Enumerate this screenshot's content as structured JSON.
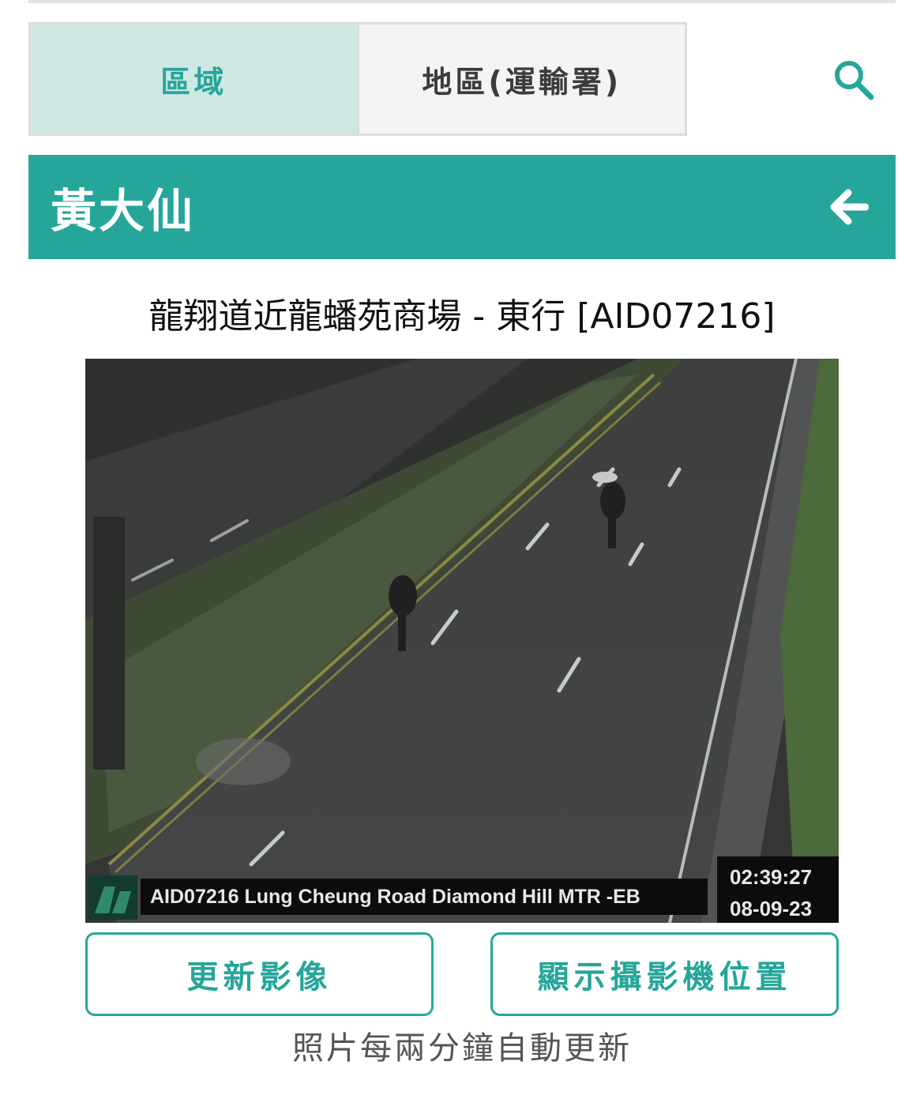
{
  "tabs": {
    "region_label": "區域",
    "district_label": "地區(運輸署)"
  },
  "icons": {
    "search": "search-icon",
    "back": "arrow-left-icon"
  },
  "banner": {
    "title": "黃大仙"
  },
  "camera": {
    "title": "龍翔道近龍蟠苑商場 - 東行 [AID07216]",
    "overlay_caption": "AID07216 Lung Cheung Road Diamond Hill MTR -EB",
    "overlay_time": "02:39:27",
    "overlay_date": "08-09-23"
  },
  "actions": {
    "refresh_label": "更新影像",
    "location_label": "顯示攝影機位置"
  },
  "footnote": "照片每兩分鐘自動更新",
  "colors": {
    "accent": "#26a69a",
    "active_tab_bg": "#cfe7e3"
  }
}
